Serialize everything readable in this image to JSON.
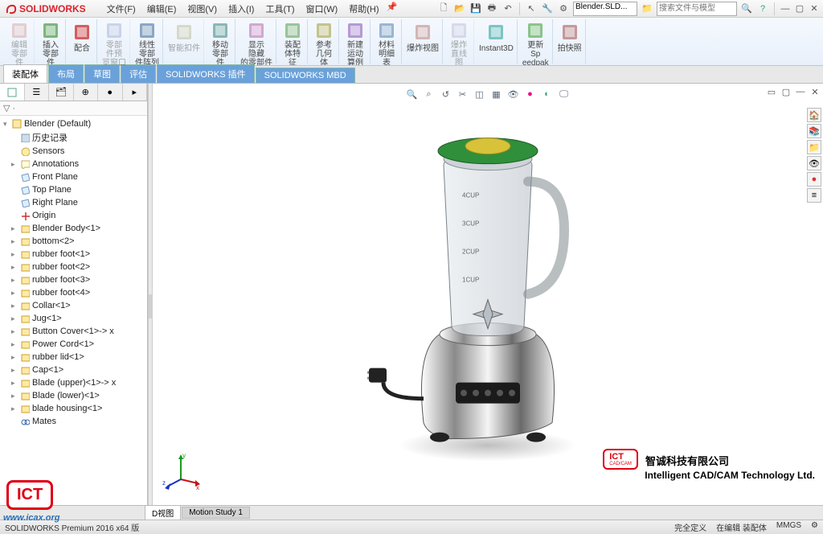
{
  "app": {
    "name": "SOLIDWORKS"
  },
  "menus": [
    "文件(F)",
    "编辑(E)",
    "视图(V)",
    "插入(I)",
    "工具(T)",
    "窗口(W)",
    "帮助(H)"
  ],
  "title_doc": "Blender.SLD...",
  "search_placeholder": "搜索文件与模型",
  "ribbon": [
    {
      "label": "编辑零部件",
      "icon": "cube-edit",
      "disabled": true
    },
    {
      "label": "插入零部件",
      "icon": "insert-comp"
    },
    {
      "label": "配合",
      "icon": "mate"
    },
    {
      "label": "零部件预览窗口",
      "icon": "preview",
      "disabled": true
    },
    {
      "label": "线性零部件阵列",
      "icon": "linear-pattern"
    },
    {
      "label": "智能扣件",
      "icon": "fastener",
      "disabled": true
    },
    {
      "label": "移动零部件",
      "icon": "move-comp"
    },
    {
      "label": "显示隐藏的零部件",
      "icon": "show-hidden"
    },
    {
      "label": "装配体特征",
      "icon": "asm-feature"
    },
    {
      "label": "参考几何体",
      "icon": "ref-geom"
    },
    {
      "label": "新建运动算例",
      "icon": "motion"
    },
    {
      "label": "材料明细表",
      "icon": "bom"
    },
    {
      "label": "爆炸视图",
      "icon": "explode"
    },
    {
      "label": "爆炸直线图",
      "icon": "explode-line",
      "disabled": true
    },
    {
      "label": "Instant3D",
      "icon": "instant3d"
    },
    {
      "label": "更新Speedpak",
      "icon": "speedpak"
    },
    {
      "label": "拍快照",
      "icon": "snapshot"
    }
  ],
  "tabs": [
    "装配体",
    "布局",
    "草图",
    "评估",
    "SOLIDWORKS 插件",
    "SOLIDWORKS MBD"
  ],
  "active_tab": 0,
  "tree_root": "Blender  (Default)",
  "tree": [
    {
      "label": "历史记录",
      "icon": "history",
      "depth": 1
    },
    {
      "label": "Sensors",
      "icon": "sensor",
      "depth": 1
    },
    {
      "label": "Annotations",
      "icon": "annot",
      "depth": 1,
      "exp": true
    },
    {
      "label": "Front Plane",
      "icon": "plane",
      "depth": 1
    },
    {
      "label": "Top Plane",
      "icon": "plane",
      "depth": 1
    },
    {
      "label": "Right Plane",
      "icon": "plane",
      "depth": 1
    },
    {
      "label": "Origin",
      "icon": "origin",
      "depth": 1
    },
    {
      "label": "Blender Body<1>",
      "icon": "part",
      "depth": 1,
      "exp": true
    },
    {
      "label": "bottom<2>",
      "icon": "part",
      "depth": 1,
      "exp": true
    },
    {
      "label": "rubber foot<1>",
      "icon": "part",
      "depth": 1,
      "exp": true
    },
    {
      "label": "rubber foot<2>",
      "icon": "part",
      "depth": 1,
      "exp": true
    },
    {
      "label": "rubber foot<3>",
      "icon": "part",
      "depth": 1,
      "exp": true
    },
    {
      "label": "rubber foot<4>",
      "icon": "part",
      "depth": 1,
      "exp": true
    },
    {
      "label": "Collar<1>",
      "icon": "part",
      "depth": 1,
      "exp": true
    },
    {
      "label": "Jug<1>",
      "icon": "part",
      "depth": 1,
      "exp": true
    },
    {
      "label": "Button Cover<1>-> x",
      "icon": "part",
      "depth": 1,
      "exp": true
    },
    {
      "label": "Power Cord<1>",
      "icon": "part",
      "depth": 1,
      "exp": true
    },
    {
      "label": "rubber lid<1>",
      "icon": "part",
      "depth": 1,
      "exp": true
    },
    {
      "label": "Cap<1>",
      "icon": "part",
      "depth": 1,
      "exp": true
    },
    {
      "label": "Blade (upper)<1>-> x",
      "icon": "part",
      "depth": 1,
      "exp": true
    },
    {
      "label": "Blade (lower)<1>",
      "icon": "part",
      "depth": 1,
      "exp": true
    },
    {
      "label": "blade housing<1>",
      "icon": "part",
      "depth": 1,
      "exp": true
    },
    {
      "label": "Mates",
      "icon": "mates",
      "depth": 1
    }
  ],
  "bottom_tabs": [
    "D视图",
    "Motion Study 1"
  ],
  "status": {
    "left": "SOLIDWORKS Premium 2016 x64 版",
    "right": [
      "完全定义",
      "在编辑 装配体",
      "MMGS"
    ]
  },
  "ict": {
    "box": "ICT",
    "sub": "CAD/CAM",
    "line1": "智诚科技有限公司",
    "line2": "Intelligent CAD/CAM Technology Ltd."
  },
  "icax": "www.icax.org",
  "triad": {
    "x": "x",
    "y": "y",
    "z": "z"
  },
  "jug_marks": [
    "4CUP",
    "3CUP",
    "2CUP",
    "1CUP"
  ]
}
